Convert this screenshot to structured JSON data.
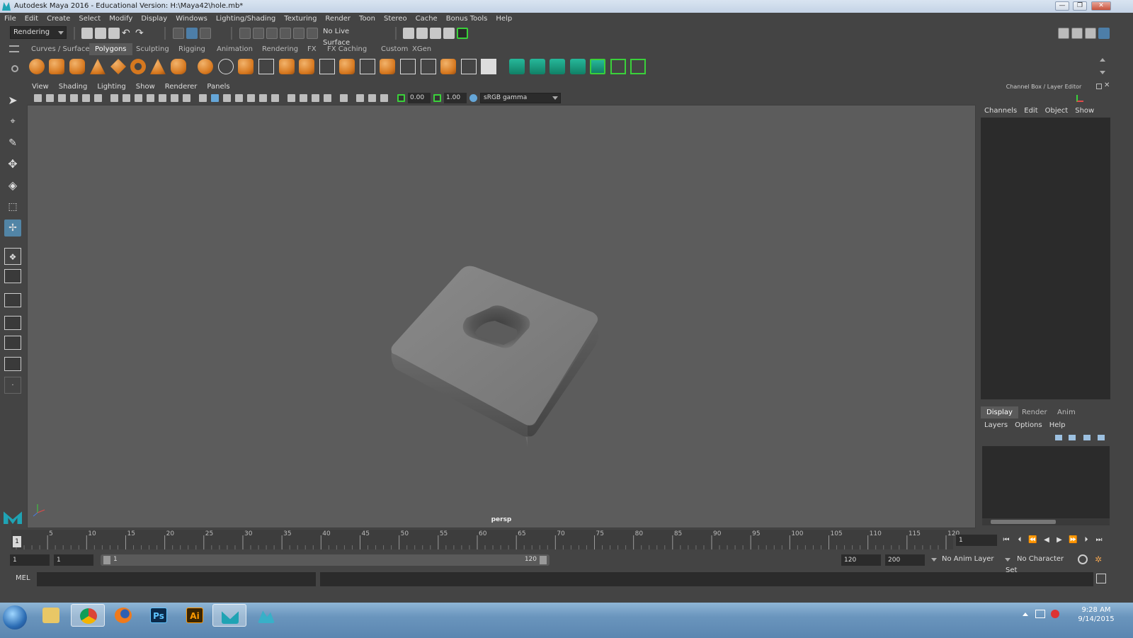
{
  "window": {
    "title": "Autodesk Maya 2016 - Educational Version: H:\\Maya42\\hole.mb*",
    "controls": [
      "—",
      "❐",
      "✕"
    ]
  },
  "menubar": [
    "File",
    "Edit",
    "Create",
    "Select",
    "Modify",
    "Display",
    "Windows",
    "Lighting/Shading",
    "Texturing",
    "Render",
    "Toon",
    "Stereo",
    "Cache",
    "Bonus Tools",
    "Help"
  ],
  "statusline": {
    "menuset": "Rendering",
    "live_surface": "No Live Surface"
  },
  "shelf": {
    "tabs": [
      "Curves / Surfaces",
      "Polygons",
      "Sculpting",
      "Rigging",
      "Animation",
      "Rendering",
      "FX",
      "FX Caching",
      "Custom",
      "XGen"
    ],
    "active_tab": "Polygons"
  },
  "viewport": {
    "menu": [
      "View",
      "Shading",
      "Lighting",
      "Show",
      "Renderer",
      "Panels"
    ],
    "exposure": "0.00",
    "gamma": "1.00",
    "color_space": "sRGB gamma",
    "camera": "persp"
  },
  "channel_box": {
    "header": "Channel Box / Layer Editor",
    "menu": [
      "Channels",
      "Edit",
      "Object",
      "Show"
    ]
  },
  "layer_editor": {
    "tabs": [
      "Display",
      "Render",
      "Anim"
    ],
    "active_tab": "Display",
    "menu": [
      "Layers",
      "Options",
      "Help"
    ]
  },
  "timeline": {
    "labels": [
      "5",
      "10",
      "15",
      "20",
      "25",
      "30",
      "35",
      "40",
      "45",
      "50",
      "55",
      "60",
      "65",
      "70",
      "75",
      "80",
      "85",
      "90",
      "95",
      "100",
      "105",
      "110",
      "115",
      "120"
    ],
    "current_frame": "1",
    "current_frame_field": "1",
    "start_frame": "1",
    "start_range": "1",
    "range_start_label": "1",
    "range_end_label": "120",
    "end_range": "120",
    "end_frame": "200",
    "anim_layer": "No Anim Layer",
    "character_set": "No Character Set"
  },
  "command_line": {
    "language": "MEL"
  },
  "taskbar": {
    "apps": [
      "start",
      "explorer",
      "chrome",
      "firefox",
      "photoshop",
      "illustrator",
      "maya",
      "mudbox"
    ],
    "ps_label": "Ps",
    "ai_label": "Ai",
    "time": "9:28 AM",
    "date": "9/14/2015"
  },
  "colors": {
    "viewport_bg": "#5c5c5c",
    "active_tool": "#5285a6",
    "shelf_orange": "#d6781f",
    "highlight_green": "#3ad13a"
  }
}
